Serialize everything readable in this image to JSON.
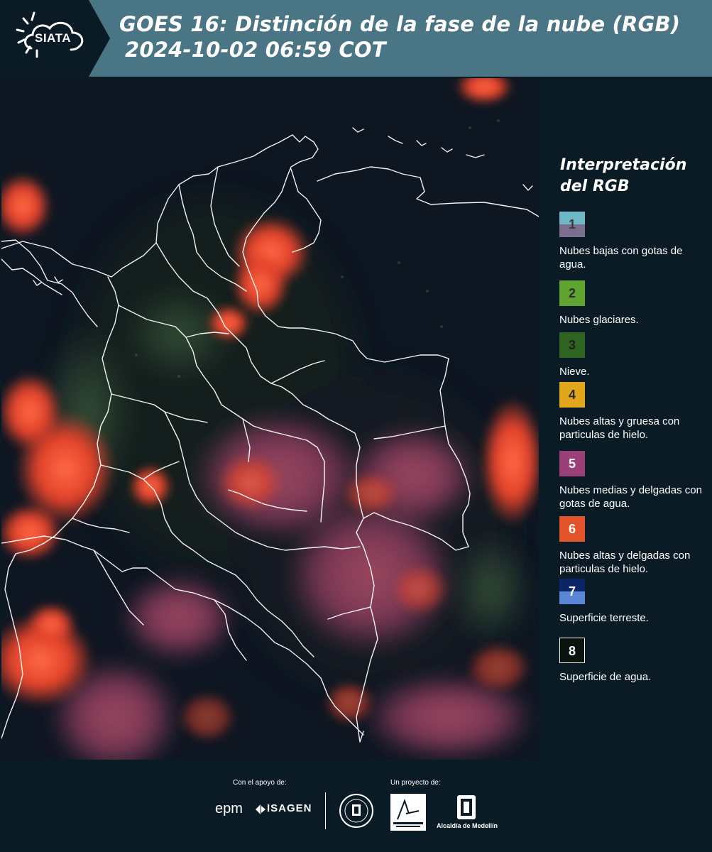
{
  "header": {
    "logo_text": "SIATA",
    "title_line1": "GOES 16: Distinción de la fase de la nube (RGB)",
    "title_line2": "2024-10-02 06:59 COT"
  },
  "legend": {
    "title_line1": "Interpretación",
    "title_line2": "del RGB",
    "items": [
      {
        "num": "1",
        "label": "Nubes bajas con gotas de agua.",
        "color_top": "#6fb7c4",
        "color_bottom": "#7b6f8d",
        "text_color": "#3a3a3a"
      },
      {
        "num": "2",
        "label": "Nubes glaciares.",
        "color_top": "#5fa431",
        "color_bottom": "#5fa431",
        "text_color": "#2b2b2b"
      },
      {
        "num": "3",
        "label": "Nieve.",
        "color_top": "#2f6520",
        "color_bottom": "#2f6520",
        "text_color": "#1d1d1d"
      },
      {
        "num": "4",
        "label": "Nubes altas y gruesa con particulas de hielo.",
        "color_top": "#e1a61b",
        "color_bottom": "#e1a61b",
        "text_color": "#2b2b2b"
      },
      {
        "num": "5",
        "label": "Nubes medias y delgadas con gotas de agua.",
        "color_top": "#9b3f79",
        "color_bottom": "#9b3f79",
        "text_color": "#ffffff"
      },
      {
        "num": "6",
        "label": "Nubes altas y delgadas con particulas de hielo.",
        "color_top": "#e4542a",
        "color_bottom": "#e4542a",
        "text_color": "#ffffff"
      },
      {
        "num": "7",
        "label": "Superficie terreste.",
        "color_top": "#0d2567",
        "color_bottom": "#5a86d6",
        "text_color": "#ffffff"
      },
      {
        "num": "8",
        "label": "Superficie de agua.",
        "color_top": "#0a120e",
        "color_bottom": "#0a120e",
        "text_color": "#ffffff"
      }
    ]
  },
  "footer": {
    "support_label": "Con el apoyo de:",
    "project_label": "Un proyecto de:",
    "sponsor_1": "epm",
    "sponsor_2": "ISAGEN",
    "partner_metro": "Área METROPOLITANA Valle de Aburrá",
    "partner_alcaldia": "Alcaldía de Medellín"
  },
  "colors": {
    "header_bg": "#4a7585",
    "page_bg": "#0b1b26",
    "map_bg": "#0e1622",
    "cloud_red": "#e24a2c",
    "cloud_magenta": "#9a4a6e",
    "border_white": "#ffffff"
  }
}
